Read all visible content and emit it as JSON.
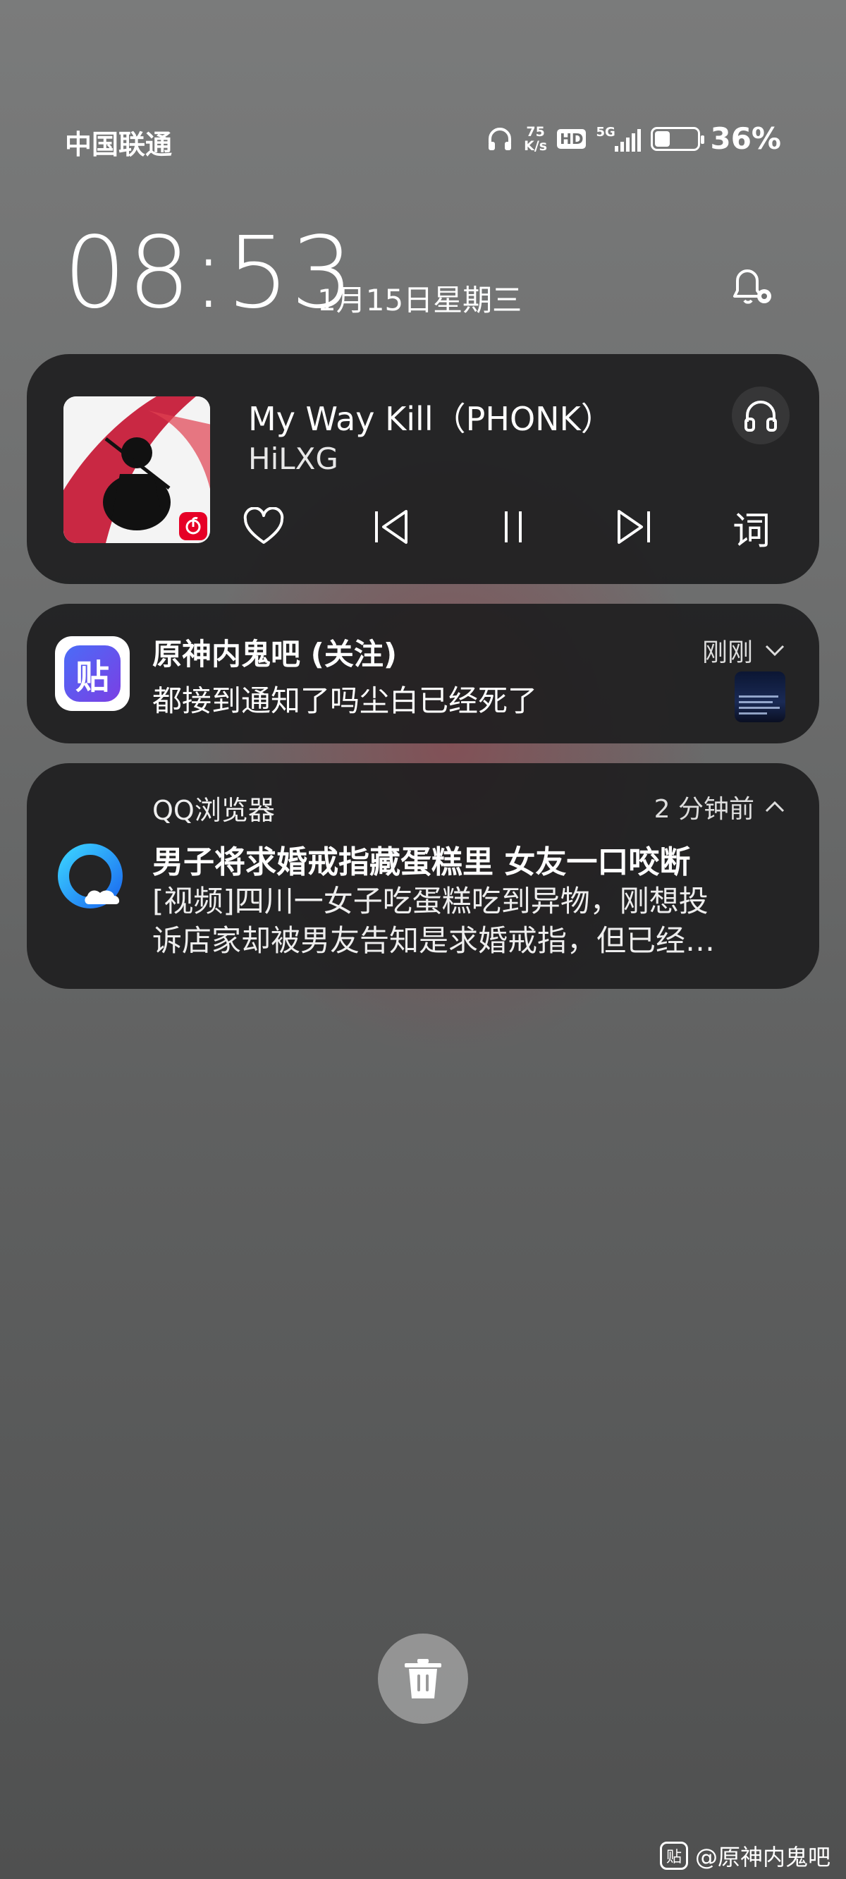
{
  "status_bar": {
    "carrier": "中国联通",
    "speed_value": "75",
    "speed_unit": "K/s",
    "hd": "HD",
    "network": "5G",
    "battery_level": 0.36,
    "battery_text": "36%"
  },
  "lockscreen": {
    "time": "08:53",
    "date": "1月15日星期三"
  },
  "music": {
    "song": "My Way Kill（PHONK）",
    "artist": "HiLXG",
    "lyrics_label": "词"
  },
  "notifications": [
    {
      "title": "原神内鬼吧 (关注)",
      "body": "都接到通知了吗尘白已经死了",
      "time": "刚刚",
      "app_icon_text": "贴"
    },
    {
      "app": "QQ浏览器",
      "time": "2 分钟前",
      "title": "男子将求婚戒指藏蛋糕里 女友一口咬断",
      "body_line1": "[视频]四川一女子吃蛋糕吃到异物，刚想投",
      "body_line2": "诉店家却被男友告知是求婚戒指，但已经…"
    }
  ],
  "watermark": {
    "logo_text": "贴",
    "text": "@原神内鬼吧"
  },
  "colors": {
    "card_bg": "#1e1e20",
    "netease_red": "#e60026",
    "tieba_blue": "#3b5bdb",
    "qq_blue": "#1e9bff"
  }
}
